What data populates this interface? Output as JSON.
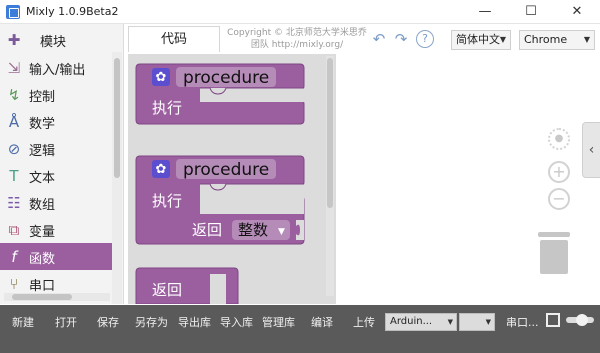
{
  "window": {
    "title": "Mixly 1.0.9Beta2",
    "minimize": "—",
    "maximize": "☐",
    "close": "✕"
  },
  "sidebar": {
    "header": "模块",
    "items": [
      {
        "label": "输入/输出",
        "icon": "input-output-icon"
      },
      {
        "label": "控制",
        "icon": "control-icon"
      },
      {
        "label": "数学",
        "icon": "math-icon"
      },
      {
        "label": "逻辑",
        "icon": "logic-icon"
      },
      {
        "label": "文本",
        "icon": "text-icon"
      },
      {
        "label": "数组",
        "icon": "array-icon"
      },
      {
        "label": "变量",
        "icon": "variable-icon"
      },
      {
        "label": "函数",
        "icon": "function-icon",
        "active": true
      },
      {
        "label": "串口",
        "icon": "serial-icon"
      }
    ]
  },
  "header": {
    "code_tab": "代码",
    "copyright_line1": "Copyright © 北京师范大学米思乔",
    "copyright_line2": "团队 http://mixly.org/",
    "language": "简体中文",
    "browser": "Chrome"
  },
  "blocks": {
    "proc1_name": "procedure",
    "proc1_exec": "执行",
    "proc2_name": "procedure",
    "proc2_exec": "执行",
    "proc2_return": "返回",
    "proc2_type": "整数",
    "return_block": "返回"
  },
  "toolbar": {
    "new": "新建",
    "open": "打开",
    "save": "保存",
    "save_as": "另存为",
    "export_lib": "导出库",
    "import_lib": "导入库",
    "manage_lib": "管理库",
    "compile": "编译",
    "upload": "上传",
    "board": "Arduin...",
    "port": "",
    "serial": "串口..."
  },
  "colors": {
    "block_purple": "#9b5fa0",
    "active_category": "#9b5fa0",
    "bottom_bar": "#5a5a5a"
  }
}
